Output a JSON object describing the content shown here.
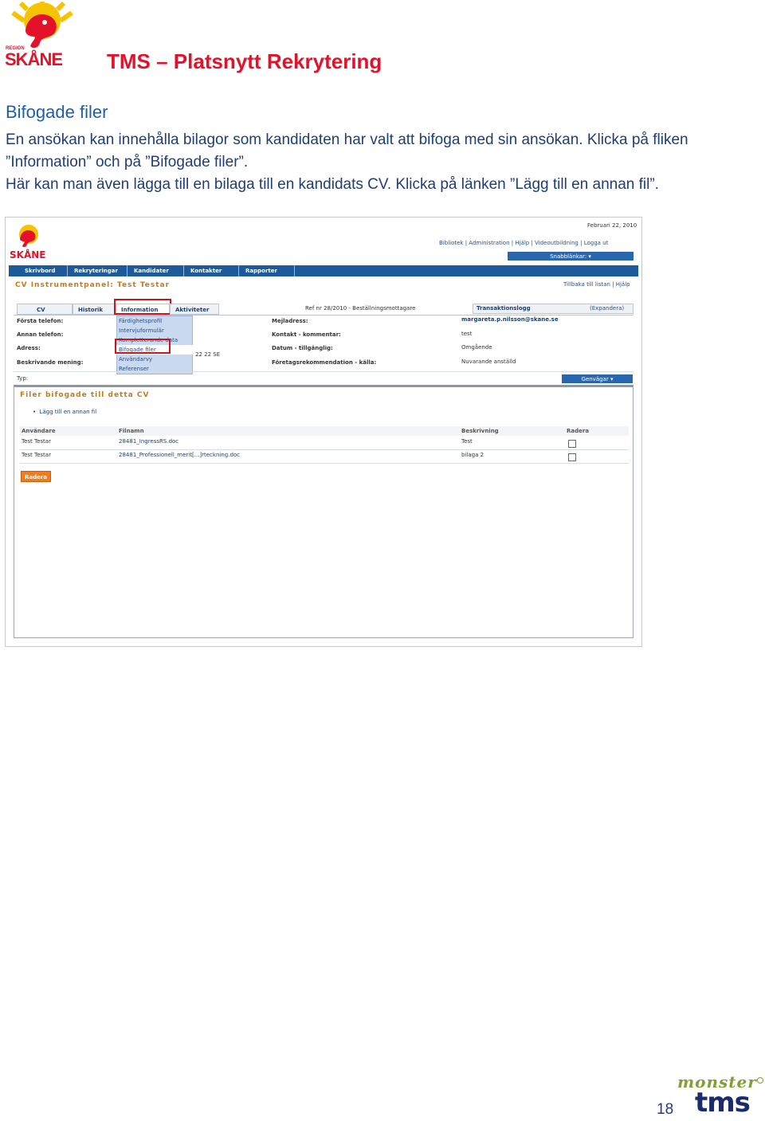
{
  "header": {
    "logo_text": "SKÅNE",
    "logo_small_text": "REGION",
    "title": "TMS – Platsnytt Rekrytering"
  },
  "section": {
    "title": "Bifogade filer",
    "paragraph_line1": "En ansökan kan innehålla bilagor som kandidaten har valt att bifoga med sin ansökan. Klicka på fliken",
    "paragraph_line2": "”Information” och på ”Bifogade filer”.",
    "paragraph_line3": "Här kan man även lägga till en bilaga till en kandidats CV. Klicka på länken ”Lägg till en annan fil”."
  },
  "screenshot": {
    "date": "Februari 22, 2010",
    "top_links": [
      "Bibliotek",
      "Administration",
      "Hjälp",
      "Videoutbildning",
      "Logga ut"
    ],
    "snabblankar": "Snabblänkar:",
    "nav_tabs": [
      "Skrivbord",
      "Rekryteringar",
      "Kandidater",
      "Kontakter",
      "Rapporter"
    ],
    "panel_title": "CV Instrumentpanel: Test Testar",
    "back_links": "Tillbaka till listan | Hjälp",
    "sub_tabs": [
      "CV",
      "Historik",
      "Information",
      "Aktiviteter"
    ],
    "ref_text": "Ref nr 28/2010 - Beställningsmottagare",
    "transaktionslogg": "Transaktionslogg",
    "expandera": "(Expandera)",
    "info_menu": [
      "Färdighetsprofil",
      "Intervjuformulär",
      "Kompletterande data",
      "Bifogade filer",
      "Användarvy",
      "Referenser"
    ],
    "left_labels": [
      "Första telefon:",
      "Annan telefon:",
      "Adress:",
      "Beskrivande mening:"
    ],
    "address_fragment": "22 22 SE",
    "mid_labels": [
      "Mejladress:",
      "Kontakt - kommentar:",
      "Datum - tillgänglig:",
      "Företagsrekommendation - källa:"
    ],
    "right_values": [
      "margareta.p.nilsson@skane.se",
      "test",
      "Omgående",
      "Nuvarande anställd"
    ],
    "typ_label": "Typ:",
    "genvagar": "Genvägar",
    "files_title": "Filer bifogade till detta CV",
    "add_file_link": "Lägg till en annan fil",
    "table_headers": [
      "Användare",
      "Filnamn",
      "Beskrivning",
      "Radera"
    ],
    "table_rows": [
      {
        "user": "Test Testar",
        "file": "28481_IngressRS.doc",
        "desc": "Test"
      },
      {
        "user": "Test Testar",
        "file": "28481_Professionell_merit[...]rteckning.doc",
        "desc": "bilaga 2"
      }
    ],
    "delete_button": "Radera"
  },
  "footer": {
    "monster": "monster",
    "tms": "tms",
    "page_number": "18"
  },
  "colors": {
    "title_red": "#e3122a",
    "heading_blue": "#1f5fa8",
    "body_blue": "#1f3e73",
    "nav_blue": "#1d5a9c",
    "monster_green": "#7ea034",
    "tms_navy": "#1b2b6b",
    "skane_yellow": "#f6c300"
  }
}
